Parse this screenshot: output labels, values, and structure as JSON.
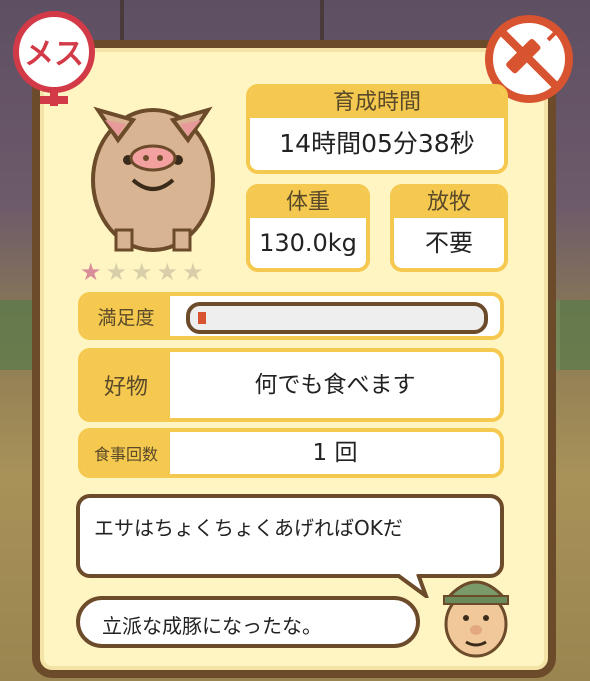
{
  "badges": {
    "gender_label": "メス"
  },
  "pig": {
    "stars_on": 1,
    "stars_total": 5
  },
  "stats": {
    "growth_time_label": "育成時間",
    "growth_time_value": "14時間05分38秒",
    "weight_label": "体重",
    "weight_value": "130.0kg",
    "grazing_label": "放牧",
    "grazing_value": "不要"
  },
  "satisfaction": {
    "label": "満足度",
    "level": 0.03
  },
  "favorite": {
    "label": "好物",
    "value": "何でも食べます"
  },
  "meals": {
    "label": "食事回数",
    "value": "1 回"
  },
  "dialogue": {
    "line1": "エサはちょくちょくあげればOKだ",
    "line2": "立派な成豚になったな。"
  },
  "colors": {
    "accent": "#f5c94f",
    "frame": "#6b4b2a",
    "female": "#d33a47",
    "noinject": "#d8532f"
  }
}
